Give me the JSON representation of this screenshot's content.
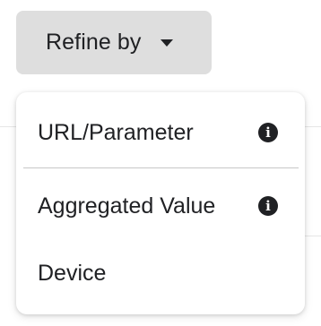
{
  "refine_button": {
    "label": "Refine by"
  },
  "menu": {
    "items": [
      {
        "label": "URL/Parameter",
        "icon": "info-icon"
      },
      {
        "label": "Aggregated Value",
        "icon": "info-icon"
      },
      {
        "label": "Device"
      }
    ],
    "info_glyph": "i"
  }
}
